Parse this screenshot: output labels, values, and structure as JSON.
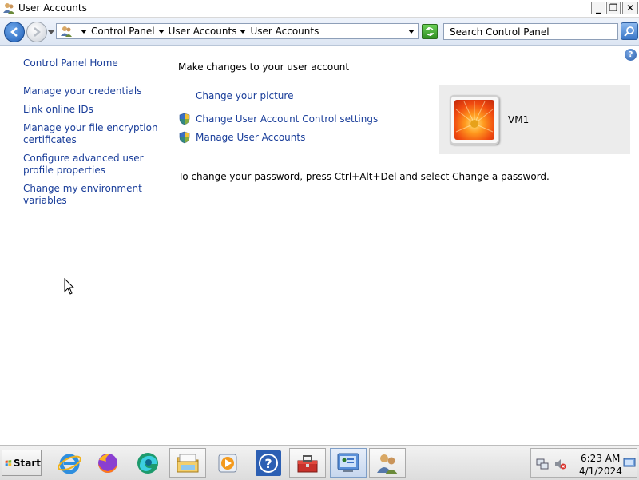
{
  "window": {
    "title": "User Accounts",
    "buttons": {
      "minimize": "_",
      "maximize": "❐",
      "close": "✕"
    }
  },
  "address_bar": {
    "crumbs": [
      "Control Panel",
      "User Accounts",
      "User Accounts"
    ],
    "search_placeholder": "Search Control Panel"
  },
  "help": {
    "label": "?"
  },
  "sidebar": {
    "home": "Control Panel Home",
    "items": [
      {
        "label": "Manage your credentials"
      },
      {
        "label": "Link online IDs"
      },
      {
        "label": "Manage your file encryption certificates"
      },
      {
        "label": "Configure advanced user profile properties"
      },
      {
        "label": "Change my environment variables"
      }
    ]
  },
  "main": {
    "heading": "Make changes to your user account",
    "tasks": {
      "change_picture": "Change your picture",
      "uac_settings": "Change User Account Control settings",
      "manage_accounts": "Manage User Accounts"
    },
    "password_note": "To change your password, press Ctrl+Alt+Del and select Change a password."
  },
  "user": {
    "name": "VM1"
  },
  "taskbar": {
    "start_label": "Start",
    "apps": [
      {
        "name": "internet-explorer-icon"
      },
      {
        "name": "firefox-icon"
      },
      {
        "name": "edge-icon"
      },
      {
        "name": "file-explorer-icon"
      },
      {
        "name": "media-player-icon"
      },
      {
        "name": "help-support-icon"
      },
      {
        "name": "toolbox-icon"
      },
      {
        "name": "control-panel-icon"
      },
      {
        "name": "user-accounts-icon"
      }
    ],
    "clock": {
      "time": "6:23 AM",
      "date": "4/1/2024"
    }
  },
  "colors": {
    "link": "#1a3e9a",
    "user_card_bg": "#ececec"
  }
}
